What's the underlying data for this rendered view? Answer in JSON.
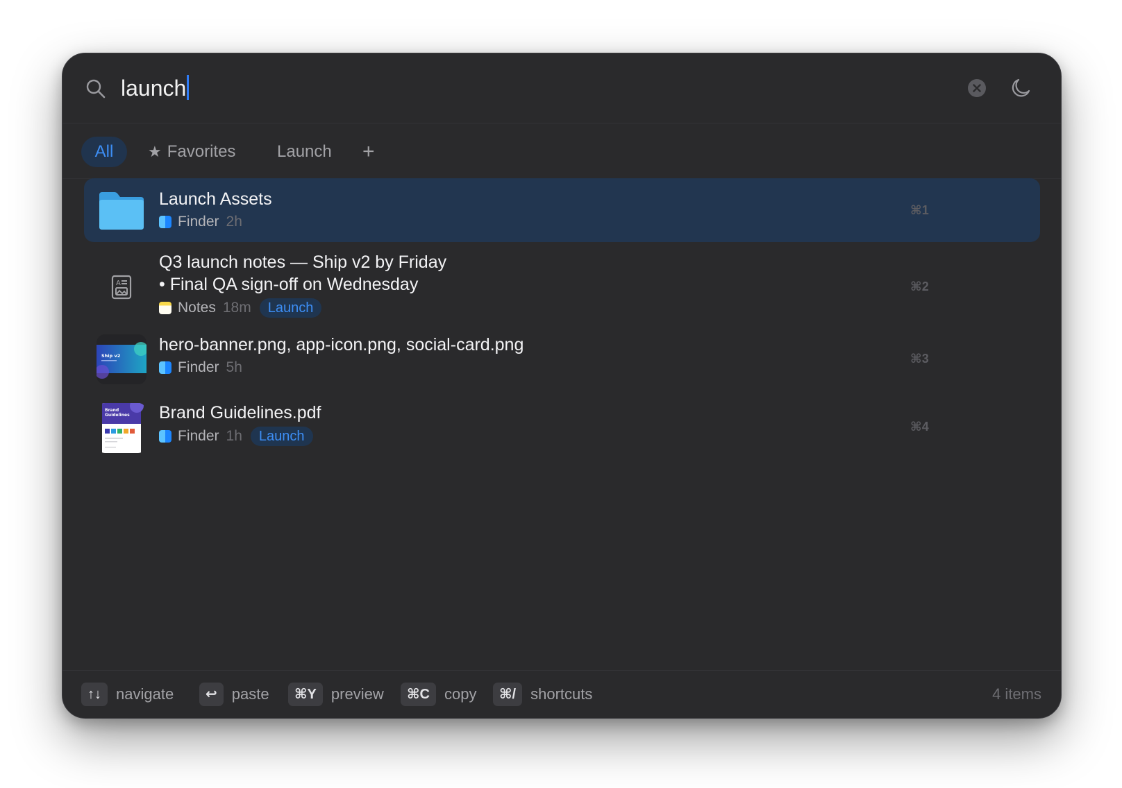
{
  "search": {
    "query": "launch"
  },
  "tabs": [
    {
      "label": "All",
      "active": true
    },
    {
      "label": "Favorites",
      "icon": "star-icon"
    },
    {
      "label": "Launch"
    },
    {
      "label": "+"
    }
  ],
  "results": [
    {
      "title": "Launch Assets",
      "app": "Finder",
      "time": "2h",
      "shortcut": "⌘1",
      "icon": "folder-icon",
      "selected": true
    },
    {
      "title_line1": "Q3 launch notes — Ship v2 by Friday",
      "title_line2": "• Final QA sign-off on Wednesday",
      "app": "Notes",
      "time": "18m",
      "tag": "Launch",
      "shortcut": "⌘2",
      "icon": "note-document-icon"
    },
    {
      "title": "hero-banner.png, app-icon.png, social-card.png",
      "app": "Finder",
      "time": "5h",
      "shortcut": "⌘3",
      "thumb_text": "Ship v2"
    },
    {
      "title": "Brand Guidelines.pdf",
      "app": "Finder",
      "time": "1h",
      "tag": "Launch",
      "shortcut": "⌘4",
      "thumb_text_line1": "Brand",
      "thumb_text_line2": "Guidelines"
    }
  ],
  "footer": {
    "hints": [
      {
        "keys": "↑↓",
        "label": "navigate"
      },
      {
        "keys": "↩",
        "label": "paste"
      },
      {
        "keys": "⌘Y",
        "label": "preview"
      },
      {
        "keys": "⌘C",
        "label": "copy"
      },
      {
        "keys": "⌘/",
        "label": "shortcuts"
      }
    ],
    "count": "4 items"
  },
  "colors": {
    "accent": "#2f7cf6",
    "panel": "#2a2a2c",
    "selected_row": "#223650",
    "folder": "#4fb3ee"
  }
}
